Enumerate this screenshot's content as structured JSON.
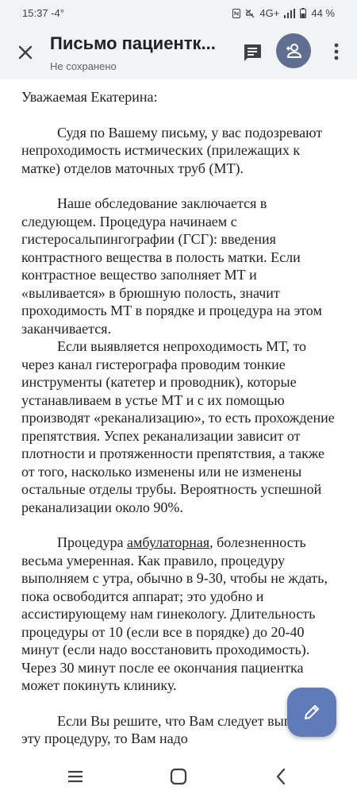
{
  "status_bar": {
    "time": "15:37",
    "temperature": "-4°",
    "network": "4G+",
    "battery": "44 %"
  },
  "app_bar": {
    "title": "Письмо пациентк...",
    "subtitle": "Не сохранено",
    "icons": [
      "close-icon",
      "comment-icon",
      "person-add-icon",
      "more-vert-icon"
    ]
  },
  "document": {
    "salutation": "Уважаемая Екатерина:",
    "p1": "Судя по Вашему письму, у вас подозревают непроходимость истмических (прилежащих к матке) отделов маточных труб (МТ).",
    "p2": "Наше обследование заключается в следующем. Процедура начинаем с гистеросальпингографии (ГСГ): введения контрастного вещества в полость матки. Если контрастное вещество заполняет МТ и «выливается» в брюшную полость, значит проходимость МТ в порядке и процедура на этом заканчивается.",
    "p3": "Если выявляется непроходимость МТ, то через канал гистерографа проводим тонкие инструменты (катетер и проводник), которые устанавливаем в устье МТ и с их помощью производят «реканализацию», то есть прохождение препятствия. Успех реканализации зависит от плотности и протяженности препятствия, а также от того, насколько изменены или не изменены остальные отделы трубы. Вероятность успешной реканализации около 90%.",
    "p4_before": "Процедура ",
    "p4_link": "амбулаторная",
    "p4_after": ", болезненность весьма умеренная. Как правило, процедуру выполняем с утра, обычно в 9-30, чтобы не ждать, пока освободится аппарат; это удобно и ассистирующему нам гинекологу. Длительность процедуры от 10 (если все в порядке) до 20-40 минут (если надо восстановить проходимость). Через 30 минут после ее окончания пациентка может покинуть клинику.",
    "p5": "Если Вы решите, что Вам следует выполнить эту процедуру, то Вам надо"
  },
  "fab": {
    "icon": "pencil-icon",
    "accent": "#5f7bb8"
  },
  "nav_bar": {
    "icons": [
      "recents-icon",
      "home-icon",
      "back-icon"
    ]
  }
}
